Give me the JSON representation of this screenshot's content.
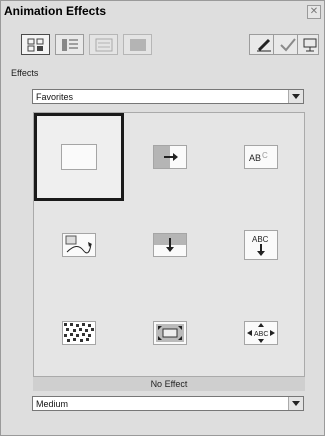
{
  "window": {
    "title": "Animation Effects"
  },
  "toolbar": {
    "left_buttons": [
      {
        "icon": "effects-gallery-icon",
        "pressed": true
      },
      {
        "icon": "effect-order-icon",
        "pressed": false
      },
      {
        "icon": "custom-animation-icon",
        "pressed": false,
        "disabled": true
      },
      {
        "icon": "preview-disabled-icon",
        "pressed": false,
        "disabled": true
      }
    ],
    "right_buttons": [
      {
        "icon": "pencil-icon"
      },
      {
        "icon": "check-icon"
      },
      {
        "icon": "slide-show-icon"
      }
    ]
  },
  "effects": {
    "label": "Effects",
    "category_select": "Favorites",
    "gallery_items": [
      "no-effect",
      "wipe-right",
      "text-fly-in",
      "path-motion",
      "wipe-down",
      "text-drop",
      "dissolve",
      "box-out",
      "text-stretch"
    ],
    "selected_index": 0,
    "status_text": "No Effect"
  },
  "speed": {
    "select": "Medium"
  }
}
